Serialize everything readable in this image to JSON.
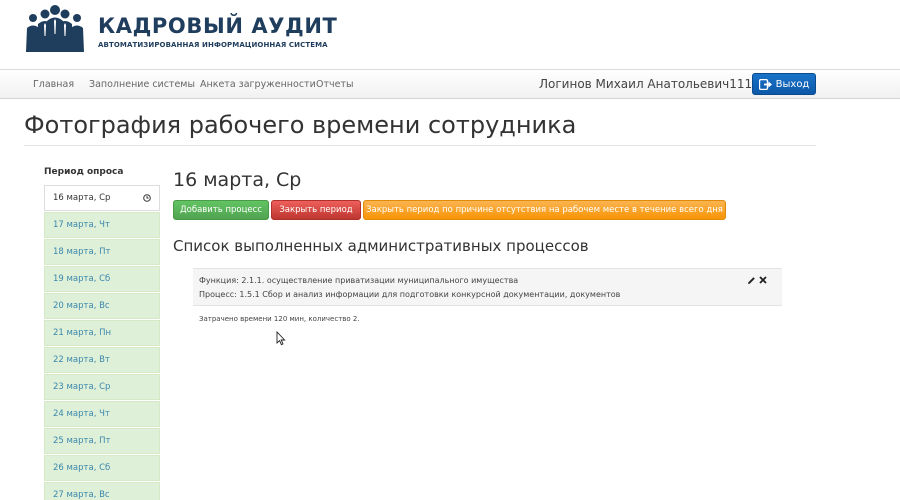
{
  "header": {
    "title": "КАДРОВЫЙ АУДИТ",
    "subtitle": "АВТОМАТИЗИРОВАННАЯ ИНФОРМАЦИОННАЯ СИСТЕМА",
    "brand_color": "#1f3d5c"
  },
  "navbar": {
    "items": [
      "Главная",
      "Заполнение системы",
      "Анкета загруженности",
      "Отчеты"
    ],
    "user_name": "Логинов Михаил Анатольевич111",
    "logout_label": "Выход",
    "logout_icon": "logout-icon"
  },
  "page": {
    "title": "Фотография рабочего времени сотрудника"
  },
  "sidebar": {
    "heading": "Период опроса",
    "items": [
      "16 марта, Ср",
      "17 марта, Чт",
      "18 марта, Пт",
      "19 марта, Сб",
      "20 марта, Вс",
      "21 марта, Пн",
      "22 марта, Вт",
      "23 марта, Ср",
      "24 марта, Чт",
      "25 марта, Пт",
      "26 марта, Сб",
      "27 марта, Вс"
    ],
    "active_index": 0,
    "active_icon": "clock-icon"
  },
  "main": {
    "day_title": "16 марта, Ср",
    "buttons": {
      "add_process": "Добавить процесс",
      "close_period": "Закрыть период",
      "close_period_absence": "Закрыть период по причине отсутствия на рабочем месте в течение всего дня"
    },
    "section_title": "Список выполненных административных процессов",
    "process": {
      "function_line": "Функция: 2.1.1. осуществление приватизации муниципального имущества",
      "process_line": "Процесс: 1.5.1 Сбор и анализ информации для подготовки конкурсной документации, документов"
    },
    "time_summary": "Затрачено времени 120 мин, количество 2."
  },
  "colors": {
    "success": "#5bb75b",
    "danger": "#da4f49",
    "warning": "#faa732",
    "primary": "#0e63b8",
    "period_bg": "#dff0d8",
    "link": "#3a87ad"
  }
}
